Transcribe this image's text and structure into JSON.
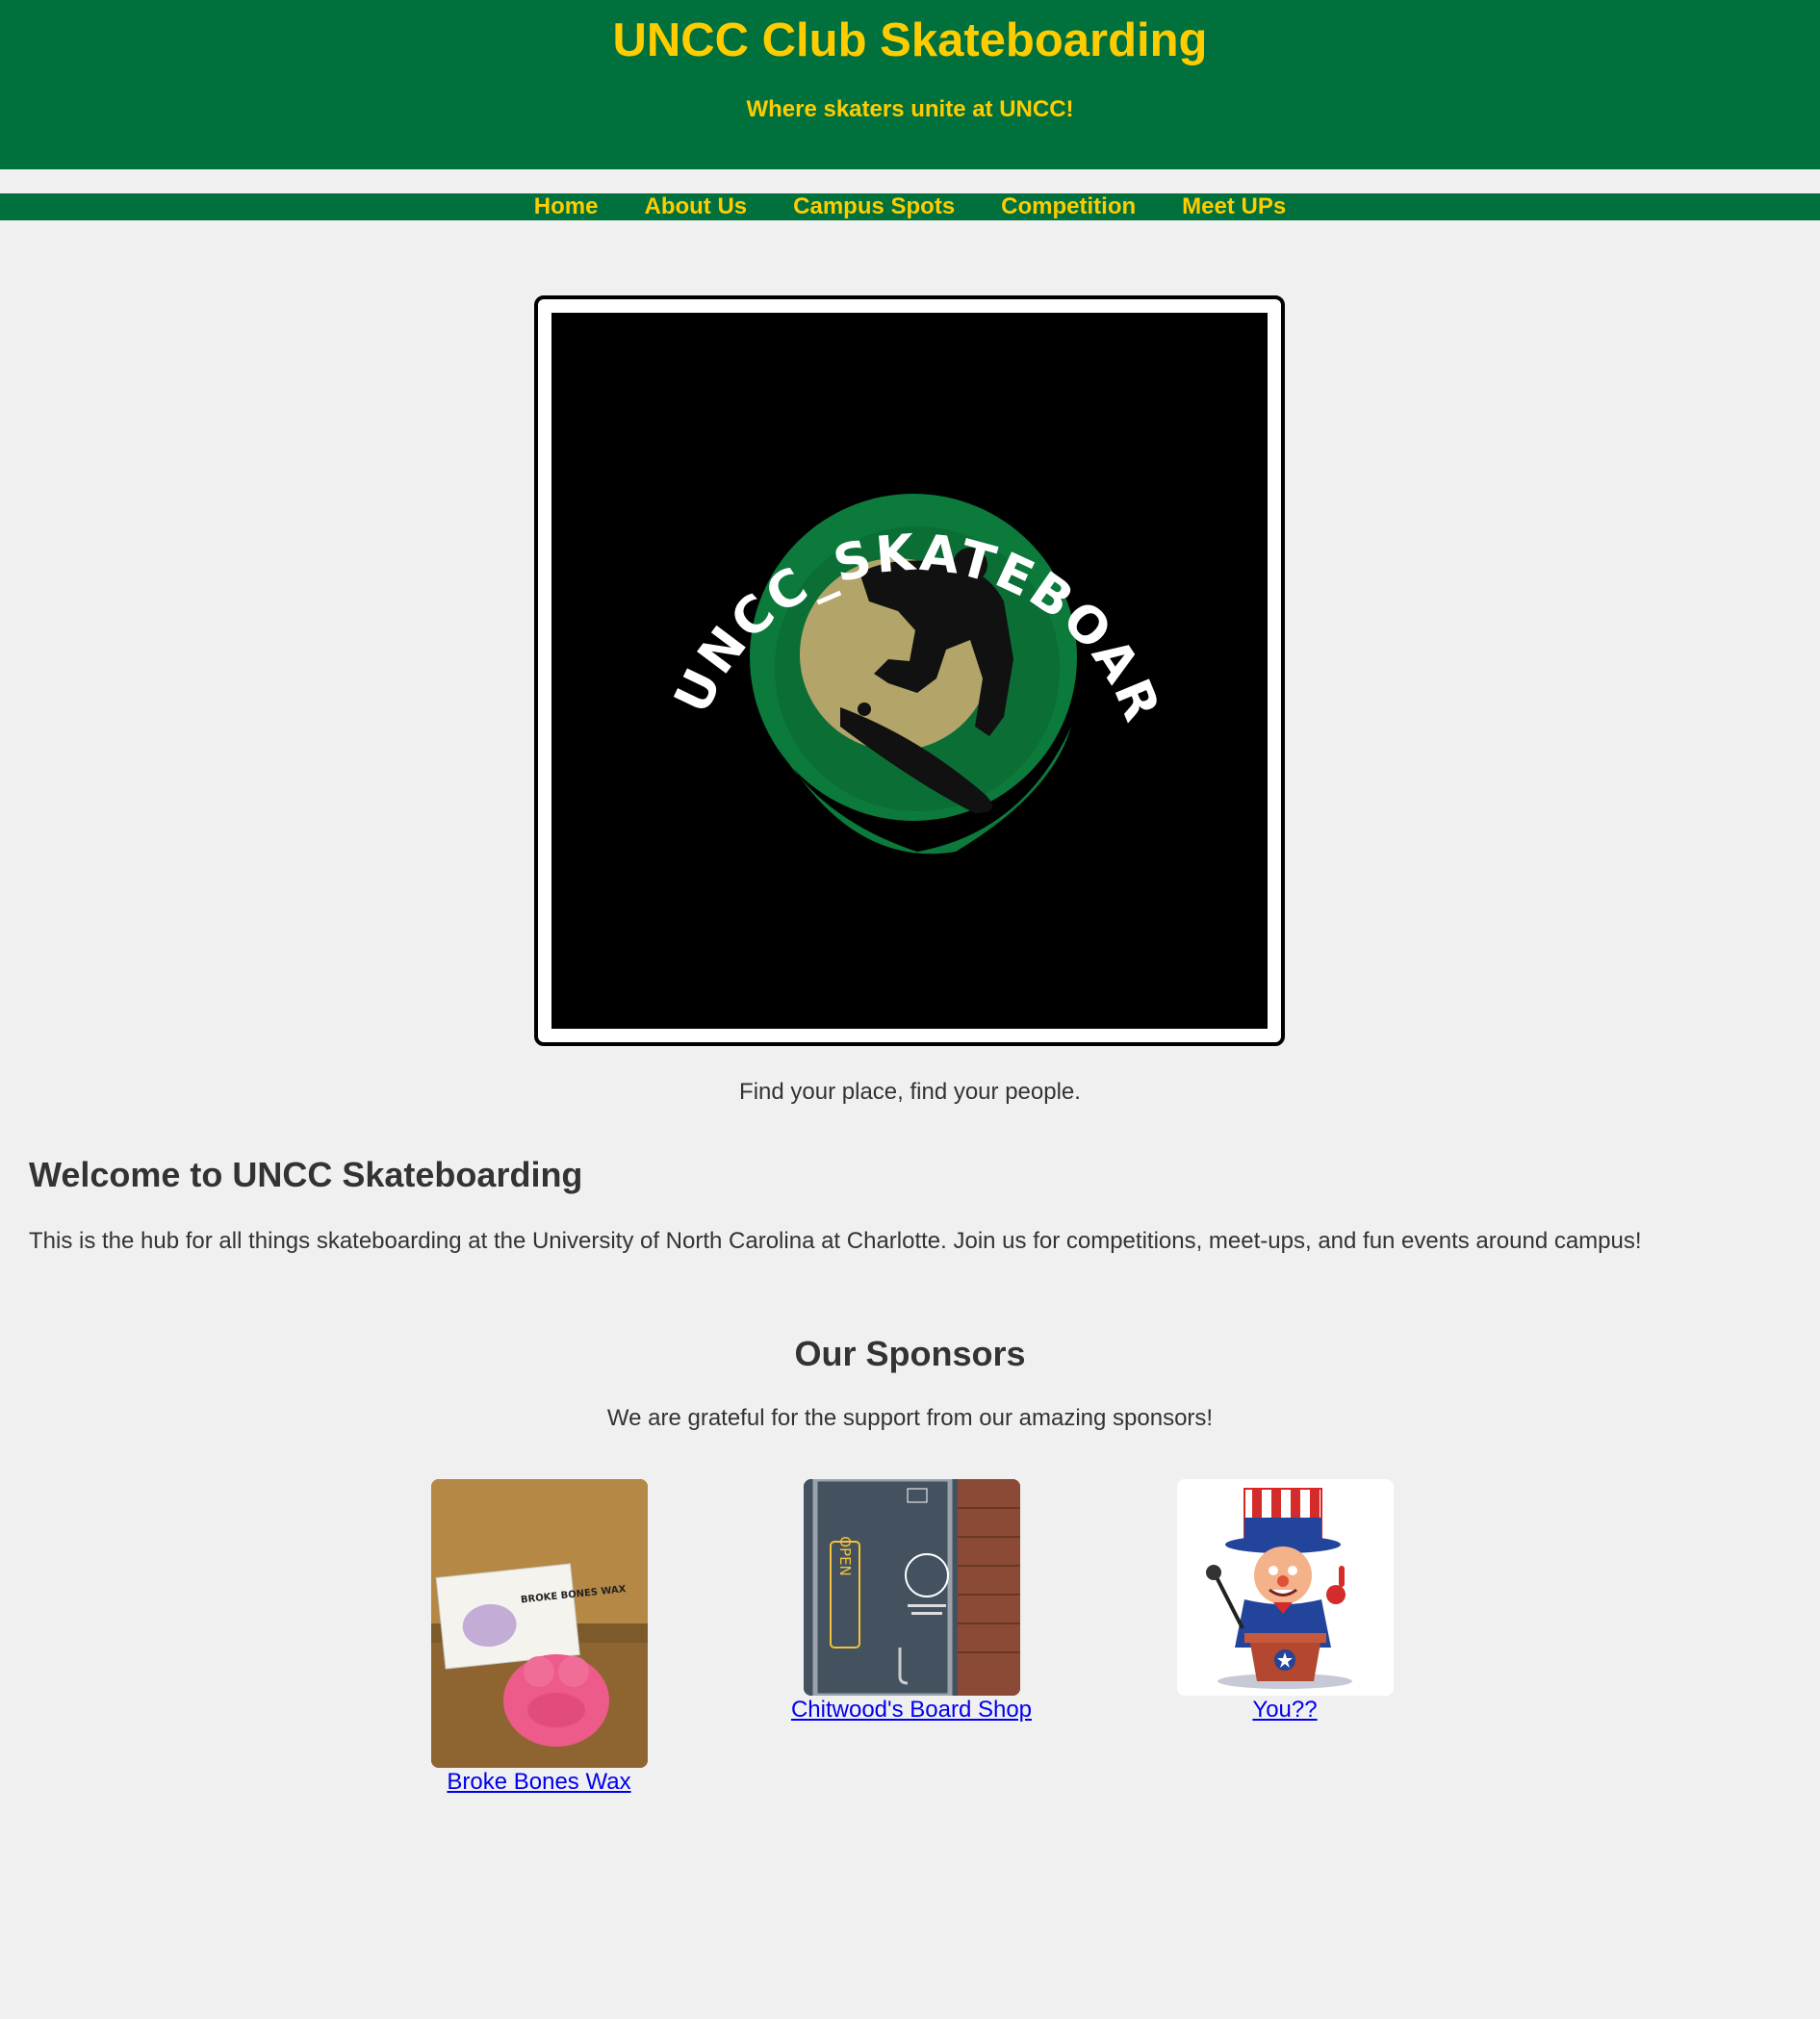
{
  "header": {
    "title": "UNCC Club Skateboarding",
    "tagline": "Where skaters unite at UNCC!"
  },
  "nav": {
    "items": [
      "Home",
      "About Us",
      "Campus Spots",
      "Competition",
      "Meet UPs"
    ]
  },
  "hero": {
    "logo_text": "UNCC_SKATEBOARDING",
    "caption": "Find your place, find your people."
  },
  "welcome": {
    "heading": "Welcome to UNCC Skateboarding",
    "text": "This is the hub for all things skateboarding at the University of North Carolina at Charlotte. Join us for competitions, meet-ups, and fun events around campus!"
  },
  "sponsors": {
    "heading": "Our Sponsors",
    "text": "We are grateful for the support from our amazing sponsors!",
    "items": [
      {
        "label": "Broke Bones Wax",
        "photo_text": "BROKE BONES WAX"
      },
      {
        "label": "Chitwood's Board Shop",
        "photo_text": "OPEN"
      },
      {
        "label": "You??"
      }
    ]
  },
  "colors": {
    "brand_green": "#00703c",
    "brand_gold": "#ffcc00",
    "page_bg": "#f0f0f0",
    "link": "#0000ee"
  }
}
